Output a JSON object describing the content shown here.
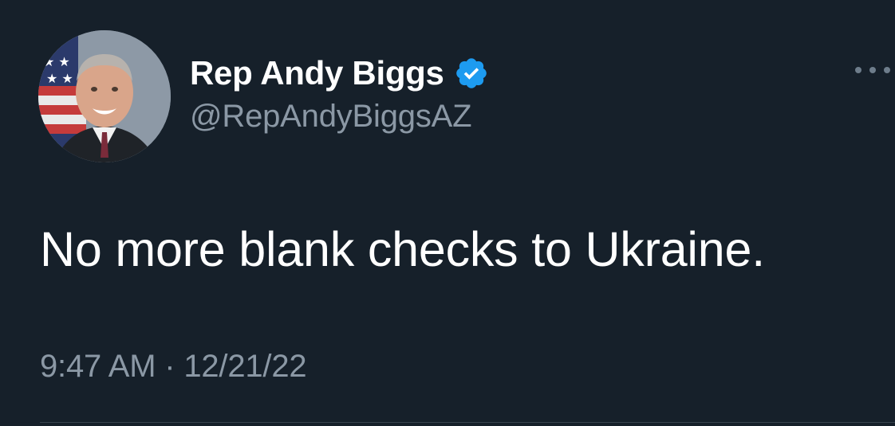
{
  "tweet": {
    "author": {
      "display_name": "Rep Andy Biggs",
      "handle": "@RepAndyBiggsAZ",
      "verified": true,
      "avatar": "avatar-photo"
    },
    "text": "No more blank checks to Ukraine.",
    "time": "9:47 AM",
    "separator": "·",
    "date": "12/21/22",
    "more_icon": "more-horizontal-icon"
  },
  "colors": {
    "background": "#16202a",
    "primary_text": "#ffffff",
    "secondary_text": "#8b98a5",
    "verified_blue": "#1d9bf0",
    "divider": "#38444d"
  }
}
